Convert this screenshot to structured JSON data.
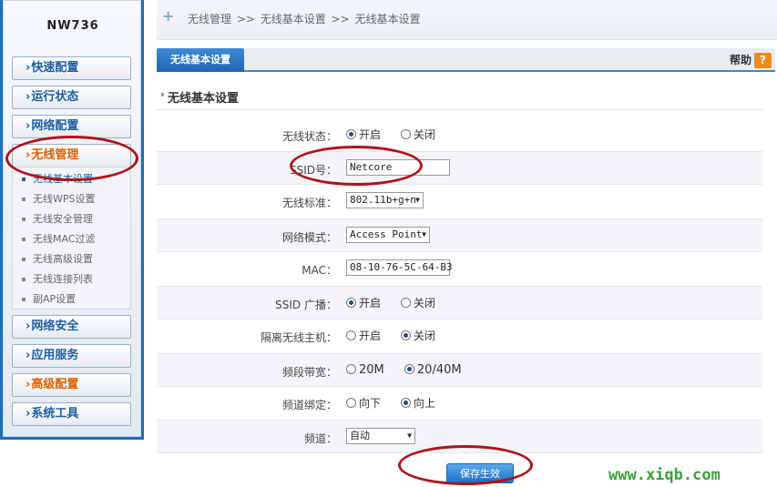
{
  "device": {
    "model": "NW736"
  },
  "sidebar": {
    "menu": [
      {
        "label": "快速配置"
      },
      {
        "label": "运行状态"
      },
      {
        "label": "网络配置"
      },
      {
        "label": "无线管理"
      },
      {
        "label": "网络安全"
      },
      {
        "label": "应用服务"
      },
      {
        "label": "高级配置"
      },
      {
        "label": "系统工具"
      }
    ],
    "submenu": [
      {
        "label": "无线基本设置"
      },
      {
        "label": "无线WPS设置"
      },
      {
        "label": "无线安全管理"
      },
      {
        "label": "无线MAC过滤"
      },
      {
        "label": "无线高级设置"
      },
      {
        "label": "无线连接列表"
      },
      {
        "label": "副AP设置"
      }
    ]
  },
  "breadcrumb": {
    "text": "无线管理 >> 无线基本设置 >> 无线基本设置"
  },
  "tab": {
    "label": "无线基本设置"
  },
  "help": {
    "label": "帮助",
    "icon": "?"
  },
  "section": {
    "title": "无线基本设置"
  },
  "form": {
    "wireless_status": {
      "label": "无线状态：",
      "opt_on": "开启",
      "opt_off": "关闭",
      "selected": "on"
    },
    "ssid": {
      "label": "SSID号：",
      "value": "Netcore"
    },
    "standard": {
      "label": "无线标准：",
      "value": "802.11b+g+n"
    },
    "mode": {
      "label": "网络模式：",
      "value": "Access Point"
    },
    "mac": {
      "label": "MAC：",
      "value": "08-10-76-5C-64-B3"
    },
    "ssid_broadcast": {
      "label": "SSID 广播：",
      "opt_on": "开启",
      "opt_off": "关闭",
      "selected": "on"
    },
    "isolate": {
      "label": "隔离无线主机：",
      "opt_on": "开启",
      "opt_off": "关闭",
      "selected": "off"
    },
    "bandwidth": {
      "label": "频段带宽：",
      "opt_a": "20M",
      "opt_b": "20/40M",
      "selected": "b"
    },
    "channel_bind": {
      "label": "频道绑定：",
      "opt_a": "向下",
      "opt_b": "向上",
      "selected": "b"
    },
    "channel": {
      "label": "频道：",
      "value": "自动"
    }
  },
  "save_button": {
    "label": "保存生效"
  },
  "watermark": {
    "text": "www.xiqb.com"
  },
  "colors": {
    "accent": "#1f6fb8",
    "active_menu": "#e06000",
    "annotation": "#b0121b",
    "watermark": "#3aa03a"
  }
}
